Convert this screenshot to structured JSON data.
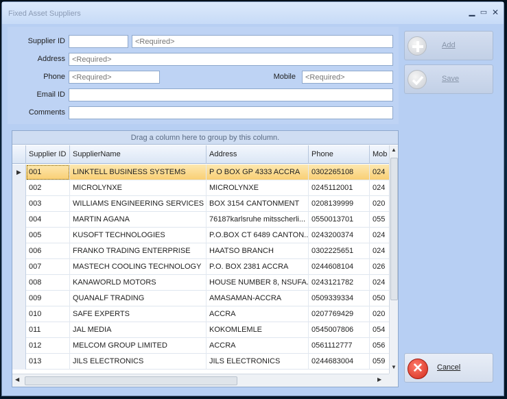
{
  "window": {
    "title": "Fixed Asset Suppliers",
    "controls": {
      "minimize": "▁",
      "maximize": "▭",
      "close": "✕"
    }
  },
  "form": {
    "supplier_id": {
      "label": "Supplier ID",
      "value": "",
      "name_placeholder": "<Required>"
    },
    "address": {
      "label": "Address",
      "placeholder": "<Required>"
    },
    "phone": {
      "label": "Phone",
      "placeholder": "<Required>"
    },
    "mobile": {
      "label": "Mobile",
      "placeholder": "<Required>"
    },
    "email": {
      "label": "Email ID",
      "value": ""
    },
    "comments": {
      "label": "Comments",
      "value": ""
    }
  },
  "actions": {
    "add_label": "Add",
    "save_label": "Save",
    "cancel_label": "Cancel",
    "add_icon": "plus-circle-icon",
    "save_icon": "checkmark-circle-icon",
    "cancel_icon": "close-circle-icon"
  },
  "grid": {
    "group_hint": "Drag a column here to group by this column.",
    "columns": [
      "Supplier ID",
      "SupplierName",
      "Address",
      "Phone",
      "Mob"
    ],
    "selected_row": 0,
    "rows": [
      [
        "001",
        "LINKTELL BUSINESS SYSTEMS",
        "P O BOX GP 4333 ACCRA",
        "0302265108",
        "024"
      ],
      [
        "002",
        "MICROLYNXE",
        "MICROLYNXE",
        "0245112001",
        "024"
      ],
      [
        "003",
        "WILLIAMS ENGINEERING SERVICES",
        "BOX 3154 CANTONMENT",
        "0208139999",
        "020"
      ],
      [
        "004",
        "MARTIN AGANA",
        "76187karlsruhe mitsscherli...",
        "0550013701",
        "055"
      ],
      [
        "005",
        "KUSOFT TECHNOLOGIES",
        "P.O.BOX  CT  6489  CANTON...",
        "0243200374",
        "024"
      ],
      [
        "006",
        "FRANKO TRADING ENTERPRISE",
        "HAATSO BRANCH",
        "0302225651",
        "024"
      ],
      [
        "007",
        "MASTECH COOLING TECHNOLOGY",
        "P.O. BOX 2381 ACCRA",
        "0244608104",
        "026"
      ],
      [
        "008",
        "KANAWORLD MOTORS",
        "HOUSE NUMBER 8, NSUFA...",
        "0243121782",
        "024"
      ],
      [
        "009",
        "QUANALF TRADING",
        "AMASAMAN-ACCRA",
        "0509339334",
        "050"
      ],
      [
        "010",
        "SAFE EXPERTS",
        "ACCRA",
        "0207769429",
        "020"
      ],
      [
        "011",
        "JAL MEDIA",
        "KOKOMLEMLE",
        "0545007806",
        "054"
      ],
      [
        "012",
        "MELCOM GROUP LIMITED",
        "ACCRA",
        "0561112777",
        "056"
      ],
      [
        "013",
        "JILS ELECTRONICS",
        "JILS ELECTRONICS",
        "0244683004",
        "059"
      ]
    ]
  },
  "colors": {
    "window_bg": "#b7cff3",
    "selected_row": "#f9cf74",
    "cancel_icon": "#d22b1c"
  }
}
